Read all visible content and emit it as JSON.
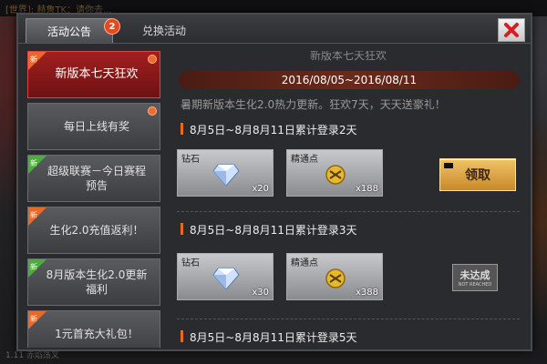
{
  "tabs": [
    {
      "label": "活动公告",
      "badge": "2"
    },
    {
      "label": "兑换活动"
    }
  ],
  "sidebar": {
    "items": [
      {
        "label": "新版本七天狂欢",
        "ribbon": "新",
        "ribbon_color": "#e8692a",
        "dot": true,
        "active": true
      },
      {
        "label": "每日上线有奖",
        "ribbon": "",
        "dot": true
      },
      {
        "label": "超级联赛－今日赛程预告",
        "ribbon": "新",
        "ribbon_color": "#4cae3a"
      },
      {
        "label": "生化2.0充值返利！",
        "ribbon": "新",
        "ribbon_color": "#e8692a"
      },
      {
        "label": "8月版本生化2.0更新福利",
        "ribbon": "新",
        "ribbon_color": "#4cae3a"
      },
      {
        "label": "1元首充大礼包！",
        "ribbon": "新",
        "ribbon_color": "#e8692a"
      }
    ]
  },
  "content": {
    "title": "新版本七天狂欢",
    "date_range": "2016/08/05~2016/08/11",
    "description": "暑期新版本生化2.0热力更新。狂欢7天，天天送豪礼！",
    "tasks": [
      {
        "title": "8月5日~8月8月11日累计登录2天",
        "rewards": [
          {
            "name": "钻石",
            "count": "x20",
            "icon": "diamond-icon"
          },
          {
            "name": "精通点",
            "count": "x188",
            "icon": "mastery-point-icon"
          }
        ],
        "status": "领取"
      },
      {
        "title": "8月5日~8月8月11日累计登录3天",
        "rewards": [
          {
            "name": "钻石",
            "count": "x30",
            "icon": "diamond-icon"
          },
          {
            "name": "精通点",
            "count": "x388",
            "icon": "mastery-point-icon"
          }
        ],
        "status_stamp": "未达成",
        "status_stamp_sub": "NOT REACHED"
      },
      {
        "title": "8月5日~8月8月11日累计登录5天"
      }
    ]
  },
  "background": {
    "top_text": "[世界]: 赫鲁TK：请你去...",
    "bottom_text": "1.11 赤焰荡叉"
  },
  "colors": {
    "accent": "#e8692a",
    "active_red": "#a21f1f",
    "claim_gold": "#e0b050"
  }
}
